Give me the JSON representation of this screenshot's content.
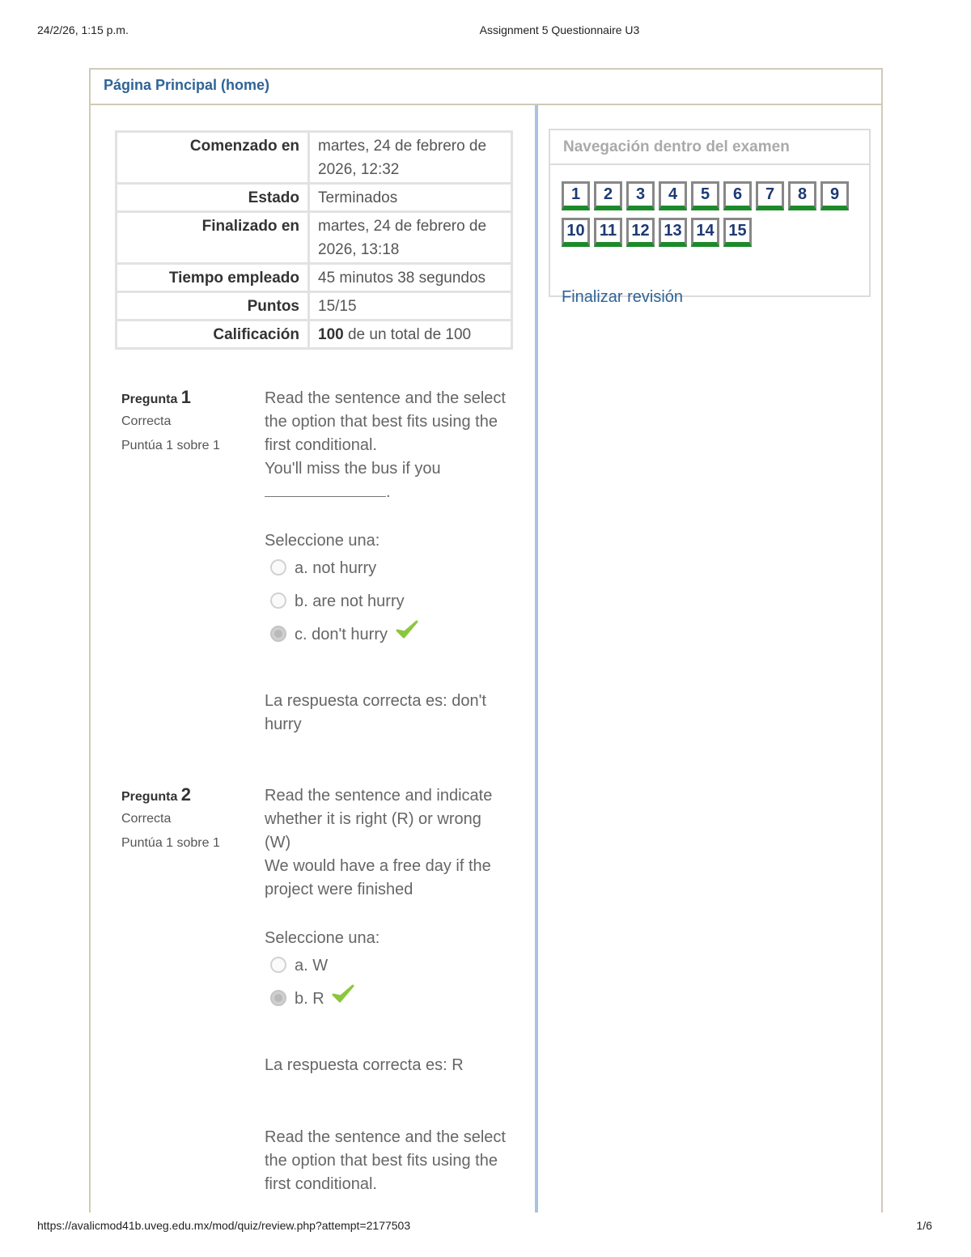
{
  "print_header": {
    "datetime": "24/2/26, 1:15 p.m.",
    "title": "Assignment 5 Questionnaire U3"
  },
  "print_footer": {
    "url": "https://avalicmod41b.uveg.edu.mx/mod/quiz/review.php?attempt=2177503",
    "page": "1/6"
  },
  "header": {
    "home_link": "Página Principal (home)"
  },
  "summary": {
    "rows": [
      {
        "label": "Comenzado en",
        "value": "martes, 24 de febrero de 2026, 12:32"
      },
      {
        "label": "Estado",
        "value": "Terminados"
      },
      {
        "label": "Finalizado en",
        "value": "martes, 24 de febrero de 2026, 13:18"
      },
      {
        "label": "Tiempo empleado",
        "value": "45 minutos 38 segundos"
      },
      {
        "label": "Puntos",
        "value": "15/15"
      }
    ],
    "grade": {
      "label": "Calificación",
      "value": "100",
      "rest": " de un total de 100"
    }
  },
  "questions": [
    {
      "label": "Pregunta",
      "number": "1",
      "state": "Correcta",
      "grade": "Puntúa 1 sobre 1",
      "text": "Read the sentence and the select the option that best fits using the first conditional.",
      "sentence": "You'll miss the bus if you",
      "blank_end": ".",
      "prompt": "Seleccione una:",
      "options": [
        {
          "label": "a. not hurry",
          "checked": false
        },
        {
          "label": "b. are not hurry",
          "checked": false
        },
        {
          "label": "c. don't hurry",
          "checked": true
        }
      ],
      "right_answer": "La respuesta correcta es: don't hurry"
    },
    {
      "label": "Pregunta",
      "number": "2",
      "state": "Correcta",
      "grade": "Puntúa 1 sobre 1",
      "text": "Read the sentence and indicate whether it is right (R) or wrong (W)",
      "sentence": "We would have a free day if the project were finished",
      "prompt": "Seleccione una:",
      "options": [
        {
          "label": "a. W",
          "checked": false
        },
        {
          "label": "b. R",
          "checked": true
        }
      ],
      "right_answer": "La respuesta correcta es: R"
    },
    {
      "text": "Read the sentence and the select the option that best fits using the first conditional."
    }
  ],
  "navigation": {
    "title": "Navegación dentro del examen",
    "buttons": [
      "1",
      "2",
      "3",
      "4",
      "5",
      "6",
      "7",
      "8",
      "9",
      "10",
      "11",
      "12",
      "13",
      "14",
      "15"
    ],
    "finish_label": "Finalizar revisión"
  },
  "colors": {
    "link": "#2f6497",
    "correct_check": "#8cc63e",
    "nav_correct_underline": "#1c8a2a",
    "divider": "#a8c4de"
  }
}
